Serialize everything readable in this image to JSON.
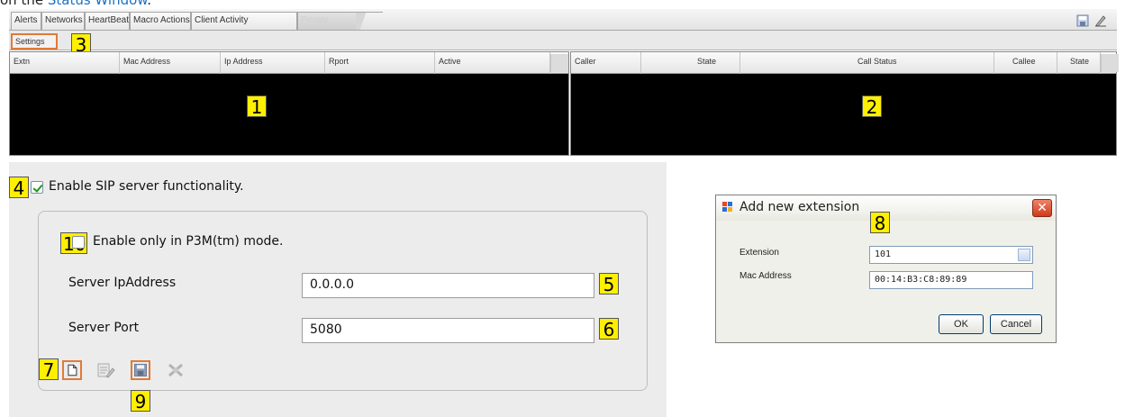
{
  "caption": {
    "prefix": "on the ",
    "link": "Status Window",
    "suffix": "."
  },
  "tabs": [
    "Alerts",
    "Networks",
    "HeartBeat",
    "Macro Actions",
    "Client Activity",
    "Private"
  ],
  "settings_label": "Settings",
  "left_table": {
    "columns": [
      "Extn",
      "Mac Address",
      "Ip Address",
      "Rport",
      "Active"
    ]
  },
  "right_table": {
    "columns": [
      "Caller",
      "State",
      "Call Status",
      "Callee",
      "State"
    ]
  },
  "sip": {
    "enable_label": "Enable SIP server functionality.",
    "enable_checked": true,
    "p3m_label": "Enable only in P3M(tm) mode.",
    "p3m_checked": false,
    "server_ip_label": "Server IpAddress",
    "server_ip_value": "0.0.0.0",
    "server_port_label": "Server Port",
    "server_port_value": "5080"
  },
  "toolbar_icons": [
    "new-icon",
    "edit-icon",
    "save-icon",
    "delete-icon"
  ],
  "dialog": {
    "title": "Add new extension",
    "close_label": "✕",
    "extension_label": "Extension",
    "extension_value": "101",
    "mac_label": "Mac Address",
    "mac_value": "00:14:B3:C8:89:89",
    "ok_label": "OK",
    "cancel_label": "Cancel"
  },
  "callouts": {
    "c1": "1",
    "c2": "2",
    "c3": "3",
    "c4": "4",
    "c5": "5",
    "c6": "6",
    "c7": "7",
    "c8": "8",
    "c9": "9",
    "c10": "10"
  },
  "colors": {
    "callout_bg": "#ffef00",
    "highlight_border": "#e07a36",
    "panel_bg": "#000000",
    "link": "#1a73c8"
  }
}
